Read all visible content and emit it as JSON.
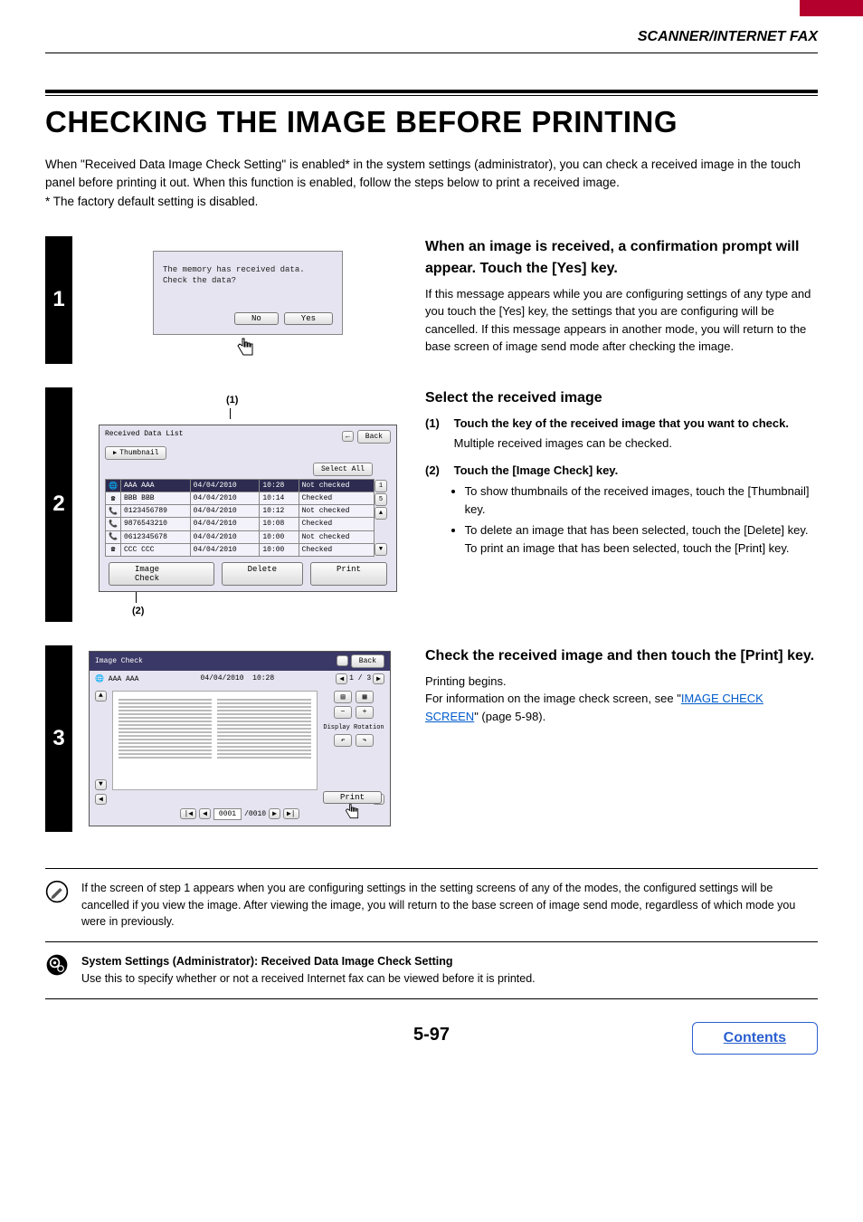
{
  "header": {
    "section": "SCANNER/INTERNET FAX"
  },
  "title": "CHECKING THE IMAGE BEFORE PRINTING",
  "intro_lines": [
    "When \"Received Data Image Check Setting\" is enabled* in the system settings (administrator), you can check a received image in the touch panel before printing it out. When this function is enabled, follow the steps below to print a received image.",
    "* The factory default setting is disabled."
  ],
  "step1": {
    "num": "1",
    "heading": "When an image is received, a confirmation prompt will appear. Touch the [Yes] key.",
    "body": "If this message appears while you are configuring settings of any type and you touch the [Yes] key, the settings that you are configuring will be cancelled. If this message appears in another mode, you will return to the base screen of image send mode after checking the image.",
    "dialog": {
      "line1": "The memory has received data.",
      "line2": "Check the data?",
      "no": "No",
      "yes": "Yes"
    }
  },
  "step2": {
    "num": "2",
    "heading": "Select the received image",
    "callout1": "(1)",
    "callout2": "(2)",
    "sub1_num": "(1)",
    "sub1_title": "Touch the key of the received image that you want to check.",
    "sub1_desc": "Multiple received images can be checked.",
    "sub2_num": "(2)",
    "sub2_title": "Touch the [Image Check] key.",
    "sub2_b1": "To show thumbnails of the received images, touch the [Thumbnail] key.",
    "sub2_b2": "To delete an image that has been selected, touch the [Delete] key. To print an image that has been selected, touch the [Print] key.",
    "panel": {
      "title": "Received Data List",
      "back": "Back",
      "thumbnail": "Thumbnail",
      "select_all": "Select All",
      "image_check": "Image Check",
      "delete": "Delete",
      "print": "Print",
      "scroll_top": "1",
      "scroll_mid": "5",
      "rows": [
        {
          "name": "AAA AAA",
          "date": "04/04/2010",
          "time": "10:28",
          "status": "Not checked",
          "sel": true,
          "icon": "net"
        },
        {
          "name": "BBB BBB",
          "date": "04/04/2010",
          "time": "10:14",
          "status": "Checked",
          "sel": false,
          "icon": "fax"
        },
        {
          "name": "0123456789",
          "date": "04/04/2010",
          "time": "10:12",
          "status": "Not checked",
          "sel": false,
          "icon": "phone"
        },
        {
          "name": "9876543210",
          "date": "04/04/2010",
          "time": "10:08",
          "status": "Checked",
          "sel": false,
          "icon": "phone"
        },
        {
          "name": "0612345678",
          "date": "04/04/2010",
          "time": "10:00",
          "status": "Not checked",
          "sel": false,
          "icon": "phone"
        },
        {
          "name": "CCC CCC",
          "date": "04/04/2010",
          "time": "10:00",
          "status": "Checked",
          "sel": false,
          "icon": "fax"
        }
      ]
    }
  },
  "step3": {
    "num": "3",
    "heading": "Check the received image and then touch the [Print] key.",
    "body1": "Printing begins.",
    "body2a": "For information on the image check screen, see \"",
    "link": "IMAGE CHECK SCREEN",
    "body2b": "\" (page 5-98).",
    "panel": {
      "title": "Image Check",
      "back": "Back",
      "sender": "AAA AAA",
      "date": "04/04/2010",
      "time": "10:28",
      "page_pos": "1 / 3",
      "display_rotation": "Display Rotation",
      "print": "Print",
      "cur_page": "0001",
      "total_page": "/0010"
    }
  },
  "note1": "If the screen of step 1 appears when you are configuring settings in the setting screens of any of the modes, the configured settings will be cancelled if you view the image. After viewing the image, you will return to the base screen of image send mode, regardless of which mode you were in previously.",
  "note2_title": "System Settings (Administrator): Received Data Image Check Setting",
  "note2_body": "Use this to specify whether or not a received Internet fax can be viewed before it is printed.",
  "page_number": "5-97",
  "contents_btn": "Contents"
}
